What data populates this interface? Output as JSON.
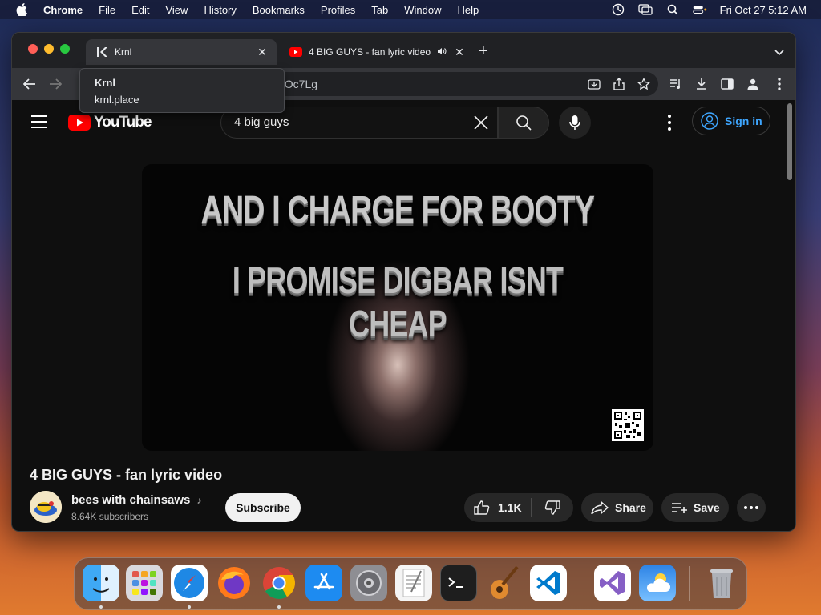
{
  "menubar": {
    "app": "Chrome",
    "items": [
      "File",
      "Edit",
      "View",
      "History",
      "Bookmarks",
      "Profiles",
      "Tab",
      "Window",
      "Help"
    ],
    "clock": "Fri Oct 27  5:12 AM"
  },
  "tabs": [
    {
      "title": "Krnl",
      "favicon": "krnl-logo-icon"
    },
    {
      "title": "4 BIG GUYS - fan lyric video",
      "favicon": "youtube-icon"
    }
  ],
  "tooltip": {
    "title": "Krnl",
    "url": "krnl.place"
  },
  "omnibox": {
    "partial_url": "9Oc7Lg"
  },
  "youtube": {
    "logo": "YouTube",
    "search_query": "4 big guys",
    "signin": "Sign in",
    "video_overlay_lines": [
      "AND I CHARGE FOR BOOTY",
      "I PROMISE DIGBAR ISNT CHEAP"
    ],
    "video_title": "4 BIG GUYS - fan lyric video",
    "channel_name": "bees with chainsaws",
    "subscribers": "8.64K subscribers",
    "subscribe": "Subscribe",
    "likes": "1.1K",
    "share": "Share",
    "save": "Save"
  },
  "dock": {
    "apps": [
      "Finder",
      "Launchpad",
      "Safari",
      "Firefox",
      "Chrome",
      "App Store",
      "System Settings",
      "TextEdit",
      "Terminal",
      "GarageBand",
      "Visual Studio Code",
      "Visual Studio",
      "Weather",
      "Trash"
    ]
  },
  "colors": {
    "youtube_red": "#ff0000",
    "link_blue": "#3ea6ff",
    "page_bg": "#0f0f0f"
  }
}
